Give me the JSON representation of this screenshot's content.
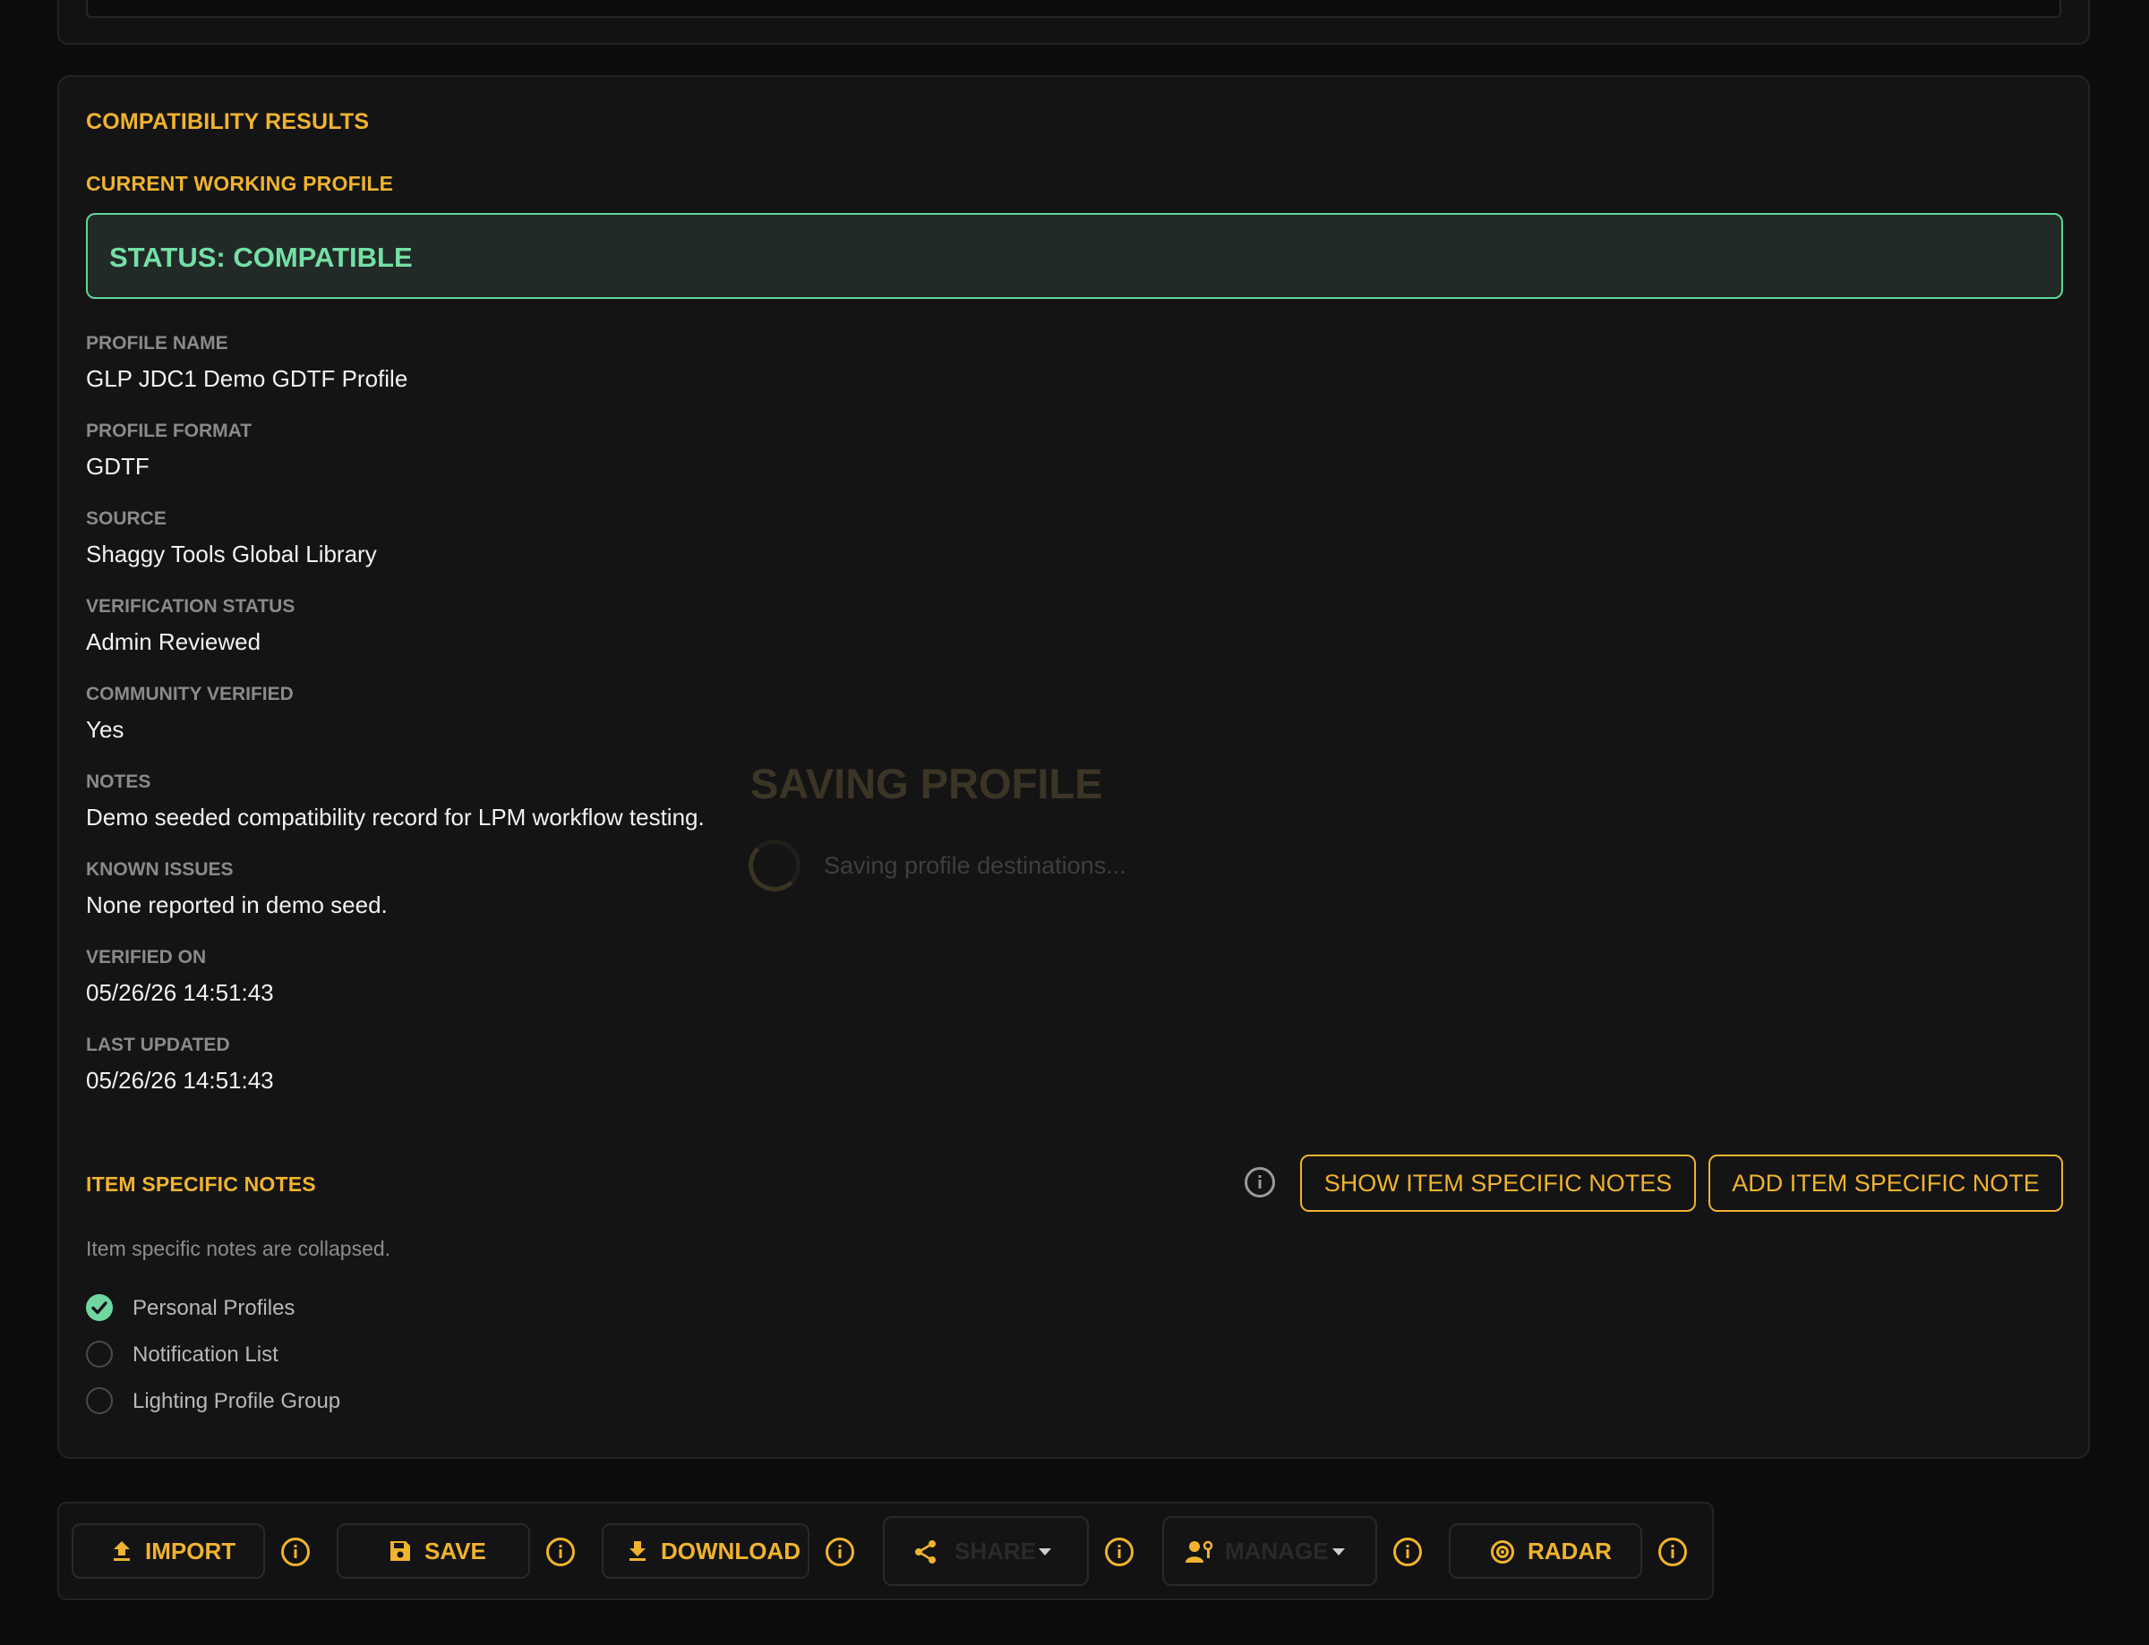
{
  "results": {
    "section_title": "COMPATIBILITY RESULTS",
    "subsection_title": "CURRENT WORKING PROFILE",
    "status_text": "STATUS: COMPATIBLE",
    "fields": [
      {
        "label": "PROFILE NAME",
        "value": "GLP JDC1 Demo GDTF Profile"
      },
      {
        "label": "PROFILE FORMAT",
        "value": "GDTF"
      },
      {
        "label": "SOURCE",
        "value": "Shaggy Tools Global Library"
      },
      {
        "label": "VERIFICATION STATUS",
        "value": "Admin Reviewed"
      },
      {
        "label": "COMMUNITY VERIFIED",
        "value": "Yes"
      },
      {
        "label": "NOTES",
        "value": "Demo seeded compatibility record for LPM workflow testing."
      },
      {
        "label": "KNOWN ISSUES",
        "value": "None reported in demo seed."
      },
      {
        "label": "VERIFIED ON",
        "value": "05/26/26 14:51:43"
      },
      {
        "label": "LAST UPDATED",
        "value": "05/26/26 14:51:43"
      }
    ]
  },
  "loading": {
    "title": "SAVING PROFILE",
    "message": "Saving profile destinations..."
  },
  "item_notes": {
    "title": "ITEM SPECIFIC NOTES",
    "show_button": "SHOW ITEM SPECIFIC NOTES",
    "add_button": "ADD ITEM SPECIFIC NOTE",
    "collapsed_text": "Item specific notes are collapsed."
  },
  "destinations": [
    {
      "label": "Personal Profiles",
      "checked": true
    },
    {
      "label": "Notification List",
      "checked": false
    },
    {
      "label": "Lighting Profile Group",
      "checked": false
    }
  ],
  "toolbar": {
    "import": "IMPORT",
    "save": "SAVE",
    "download": "DOWNLOAD",
    "share": "SHARE",
    "manage": "MANAGE",
    "radar": "RADAR"
  },
  "colors": {
    "accent": "#f0b32e",
    "status_green": "#74e0a6",
    "background": "#0c0c0d"
  },
  "icons": [
    "upload-icon",
    "floppy-disk-icon",
    "download-icon",
    "share-icon",
    "manage-users-icon",
    "radar-icon",
    "info-icon",
    "chevron-down-icon",
    "checkmark-icon"
  ]
}
